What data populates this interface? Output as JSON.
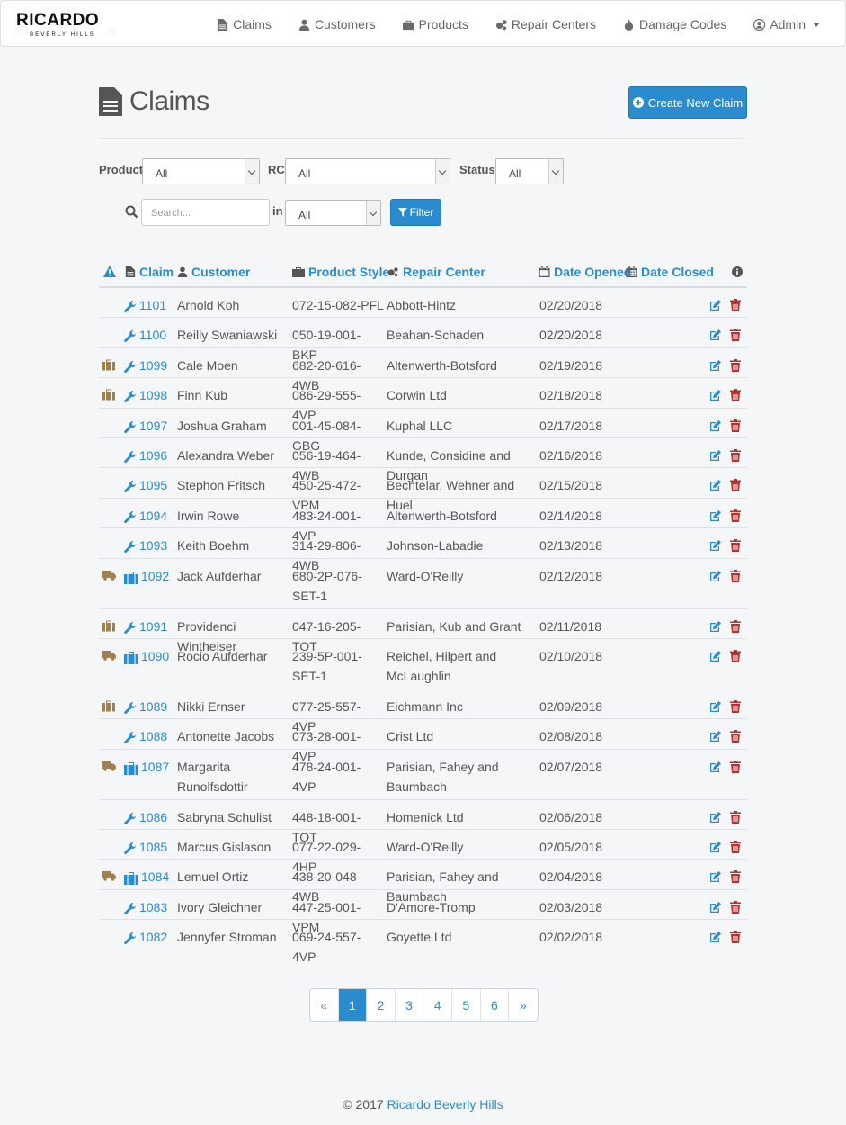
{
  "brand": {
    "name": "RICARDO",
    "tagline": "BEVERLY HILLS"
  },
  "nav": {
    "items": [
      {
        "label": "Claims",
        "icon": "file-icon"
      },
      {
        "label": "Customers",
        "icon": "user-icon"
      },
      {
        "label": "Products",
        "icon": "briefcase-icon"
      },
      {
        "label": "Repair Centers",
        "icon": "gears-icon"
      },
      {
        "label": "Damage Codes",
        "icon": "fire-icon"
      }
    ],
    "admin": {
      "label": "Admin",
      "icon": "user-circle-icon"
    }
  },
  "page": {
    "title": "Claims",
    "create_button": "Create New Claim"
  },
  "filters": {
    "product_label": "Product",
    "product_value": "All",
    "rc_label": "RC",
    "rc_value": "All",
    "status_label": "Status",
    "status_value": "All",
    "search_placeholder": "Search...",
    "in_label": "in",
    "in_value": "All",
    "filter_button": "Filter"
  },
  "table": {
    "headers": {
      "claim": "Claim",
      "customer": "Customer",
      "product_style": "Product Style",
      "repair_center": "Repair Center",
      "date_opened": "Date Opened",
      "date_closed": "Date Closed"
    },
    "rows": [
      {
        "flag": "",
        "type": "wrench",
        "claim": "1101",
        "customer": "Arnold Koh",
        "style": "072-15-082-PFL",
        "rc": "Abbott-Hintz",
        "opened": "02/20/2018",
        "lines": 1
      },
      {
        "flag": "",
        "type": "wrench",
        "claim": "1100",
        "customer": "Reilly Swaniawski",
        "style": "050-19-001-BKP",
        "rc": "Beahan-Schaden",
        "opened": "02/20/2018",
        "lines": 1
      },
      {
        "flag": "briefcase",
        "type": "wrench",
        "claim": "1099",
        "customer": "Cale Moen",
        "style": "682-20-616-4WB",
        "rc": "Altenwerth-Botsford",
        "opened": "02/19/2018",
        "lines": 1
      },
      {
        "flag": "briefcase",
        "type": "wrench",
        "claim": "1098",
        "customer": "Finn Kub",
        "style": "086-29-555-4VP",
        "rc": "Corwin Ltd",
        "opened": "02/18/2018",
        "lines": 1
      },
      {
        "flag": "",
        "type": "wrench",
        "claim": "1097",
        "customer": "Joshua Graham",
        "style": "001-45-084-GBG",
        "rc": "Kuphal LLC",
        "opened": "02/17/2018",
        "lines": 1
      },
      {
        "flag": "",
        "type": "wrench",
        "claim": "1096",
        "customer": "Alexandra Weber",
        "style": "056-19-464-4WB",
        "rc": "Kunde, Considine and Durgan",
        "opened": "02/16/2018",
        "lines": 1
      },
      {
        "flag": "",
        "type": "wrench",
        "claim": "1095",
        "customer": "Stephon Fritsch",
        "style": "450-25-472-VPM",
        "rc": "Bechtelar, Wehner and Huel",
        "opened": "02/15/2018",
        "lines": 1
      },
      {
        "flag": "",
        "type": "wrench",
        "claim": "1094",
        "customer": "Irwin Rowe",
        "style": "483-24-001-4VP",
        "rc": "Altenwerth-Botsford",
        "opened": "02/14/2018",
        "lines": 1
      },
      {
        "flag": "",
        "type": "wrench",
        "claim": "1093",
        "customer": "Keith Boehm",
        "style": "314-29-806-4WB",
        "rc": "Johnson-Labadie",
        "opened": "02/13/2018",
        "lines": 1
      },
      {
        "flag": "truck",
        "type": "suitcase",
        "claim": "1092",
        "customer": "Jack Aufderhar",
        "style": "680-2P-076-SET-1",
        "rc": "Ward-O'Reilly",
        "opened": "02/12/2018",
        "lines": 2
      },
      {
        "flag": "briefcase",
        "type": "wrench",
        "claim": "1091",
        "customer": "Providenci Wintheiser",
        "style": "047-16-205-TOT",
        "rc": "Parisian, Kub and Grant",
        "opened": "02/11/2018",
        "lines": 1
      },
      {
        "flag": "truck",
        "type": "suitcase",
        "claim": "1090",
        "customer": "Rocio Aufderhar",
        "style": "239-5P-001-SET-1",
        "rc": "Reichel, Hilpert and McLaughlin",
        "opened": "02/10/2018",
        "lines": 2
      },
      {
        "flag": "briefcase",
        "type": "wrench",
        "claim": "1089",
        "customer": "Nikki Ernser",
        "style": "077-25-557-4VP",
        "rc": "Eichmann Inc",
        "opened": "02/09/2018",
        "lines": 1
      },
      {
        "flag": "",
        "type": "wrench",
        "claim": "1088",
        "customer": "Antonette Jacobs",
        "style": "073-28-001-4VP",
        "rc": "Crist Ltd",
        "opened": "02/08/2018",
        "lines": 1
      },
      {
        "flag": "truck",
        "type": "suitcase",
        "claim": "1087",
        "customer": "Margarita Runolfsdottir",
        "style": "478-24-001-4VP",
        "rc": "Parisian, Fahey and Baumbach",
        "opened": "02/07/2018",
        "lines": 2
      },
      {
        "flag": "",
        "type": "wrench",
        "claim": "1086",
        "customer": "Sabryna Schulist",
        "style": "448-18-001-TOT",
        "rc": "Homenick Ltd",
        "opened": "02/06/2018",
        "lines": 1
      },
      {
        "flag": "",
        "type": "wrench",
        "claim": "1085",
        "customer": "Marcus Gislason",
        "style": "077-22-029-4HP",
        "rc": "Ward-O'Reilly",
        "opened": "02/05/2018",
        "lines": 1
      },
      {
        "flag": "truck",
        "type": "suitcase",
        "claim": "1084",
        "customer": "Lemuel Ortiz",
        "style": "438-20-048-4WB",
        "rc": "Parisian, Fahey and Baumbach",
        "opened": "02/04/2018",
        "lines": 1
      },
      {
        "flag": "",
        "type": "wrench",
        "claim": "1083",
        "customer": "Ivory Gleichner",
        "style": "447-25-001-VPM",
        "rc": "D'Amore-Tromp",
        "opened": "02/03/2018",
        "lines": 1
      },
      {
        "flag": "",
        "type": "wrench",
        "claim": "1082",
        "customer": "Jennyfer Stroman",
        "style": "069-24-557-4VP",
        "rc": "Goyette Ltd",
        "opened": "02/02/2018",
        "lines": 1
      }
    ]
  },
  "pagination": {
    "prev": "«",
    "pages": [
      "1",
      "2",
      "3",
      "4",
      "5",
      "6"
    ],
    "active": "1",
    "next": "»"
  },
  "footer": {
    "copyright": "© 2017",
    "link": "Ricardo Beverly Hills"
  },
  "colors": {
    "accent": "#2a8ccf",
    "brown": "#a08050",
    "danger": "#b8312f",
    "text": "#555555"
  }
}
